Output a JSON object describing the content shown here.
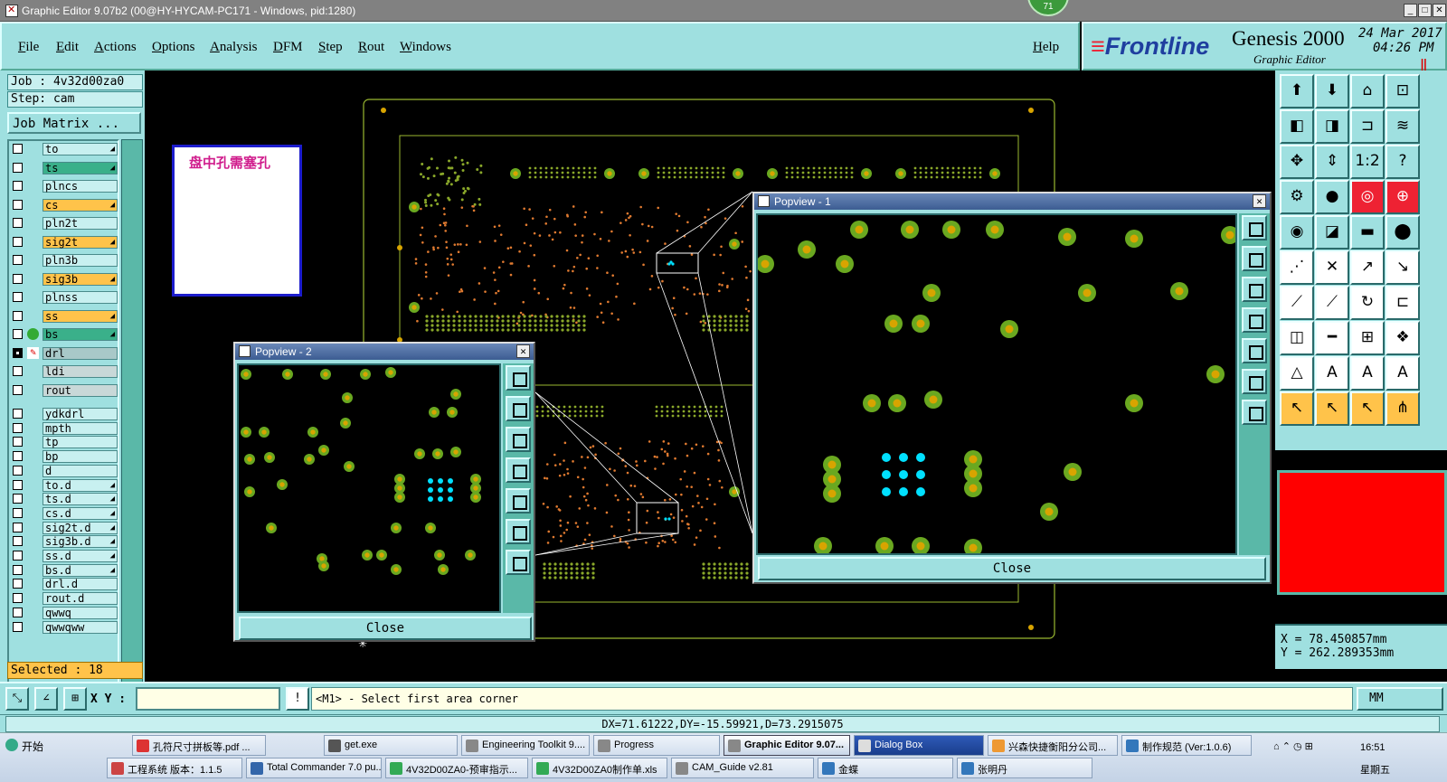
{
  "window": {
    "title": "Graphic Editor 9.07b2 (00@HY-HYCAM-PC171 - Windows, pid:1280)",
    "badge": "71",
    "min_label": "_",
    "max_label": "□",
    "close_label": "✕"
  },
  "menu": {
    "items": [
      "File",
      "Edit",
      "Actions",
      "Options",
      "Analysis",
      "DFM",
      "Step",
      "Rout",
      "Windows"
    ],
    "help": "Help"
  },
  "brand": {
    "logo": "Frontline",
    "product": "Genesis 2000",
    "subtitle": "Graphic Editor",
    "date": "24 Mar 2017",
    "time": "04:26 PM",
    "mark": "‖"
  },
  "job": {
    "job_label": "Job : 4v32d00za0",
    "step_label": "Step: cam",
    "matrix_button": "Job Matrix ..."
  },
  "layers": [
    {
      "name": "to",
      "style": "plain",
      "arrow": true,
      "affected": false
    },
    {
      "name": "ts",
      "style": "green",
      "arrow": true,
      "affected": false
    },
    {
      "name": "plncs",
      "style": "plain",
      "arrow": false,
      "affected": false
    },
    {
      "name": "cs",
      "style": "sig",
      "arrow": true,
      "affected": false
    },
    {
      "name": "pln2t",
      "style": "plain",
      "arrow": false,
      "affected": false
    },
    {
      "name": "sig2t",
      "style": "sig",
      "arrow": true,
      "affected": false
    },
    {
      "name": "pln3b",
      "style": "plain",
      "arrow": false,
      "affected": false
    },
    {
      "name": "sig3b",
      "style": "sig",
      "arrow": true,
      "affected": false
    },
    {
      "name": "plnss",
      "style": "plain",
      "arrow": false,
      "affected": false
    },
    {
      "name": "ss",
      "style": "sig",
      "arrow": true,
      "affected": false
    },
    {
      "name": "bs",
      "style": "green",
      "arrow": true,
      "affected": false,
      "display": true
    },
    {
      "name": "drl",
      "style": "selblue",
      "arrow": false,
      "affected": true,
      "work": true
    },
    {
      "name": "ldi",
      "style": "grey",
      "arrow": false,
      "affected": false
    },
    {
      "name": "rout",
      "style": "grey",
      "arrow": false,
      "affected": false
    },
    {
      "name": "ydkdrl",
      "style": "plain",
      "arrow": false,
      "affected": false
    },
    {
      "name": "mpth",
      "style": "plain",
      "arrow": false,
      "affected": false
    },
    {
      "name": "tp",
      "style": "plain",
      "arrow": false,
      "affected": false
    },
    {
      "name": "bp",
      "style": "plain",
      "arrow": false,
      "affected": false
    },
    {
      "name": "d",
      "style": "plain",
      "arrow": false,
      "affected": false
    },
    {
      "name": "to.d",
      "style": "plain",
      "arrow": true,
      "affected": false
    },
    {
      "name": "ts.d",
      "style": "plain",
      "arrow": true,
      "affected": false
    },
    {
      "name": "cs.d",
      "style": "plain",
      "arrow": true,
      "affected": false
    },
    {
      "name": "sig2t.d",
      "style": "plain",
      "arrow": true,
      "affected": false
    },
    {
      "name": "sig3b.d",
      "style": "plain",
      "arrow": true,
      "affected": false
    },
    {
      "name": "ss.d",
      "style": "plain",
      "arrow": true,
      "affected": false
    },
    {
      "name": "bs.d",
      "style": "plain",
      "arrow": true,
      "affected": false
    },
    {
      "name": "drl.d",
      "style": "plain",
      "arrow": false,
      "affected": false
    },
    {
      "name": "rout.d",
      "style": "plain",
      "arrow": false,
      "affected": false
    },
    {
      "name": "qwwq",
      "style": "plain",
      "arrow": false,
      "affected": false
    },
    {
      "name": "qwwqww",
      "style": "plain",
      "arrow": false,
      "affected": false
    }
  ],
  "selected_label": "Selected : 18",
  "note": {
    "text": "盘中孔需塞孔"
  },
  "popview1": {
    "title": "Popview - 1",
    "close_label": "Close"
  },
  "popview2": {
    "title": "Popview - 2",
    "close_label": "Close"
  },
  "colors": {
    "panel": "#9fe0e0",
    "outline": "#9ab830",
    "pad_outer": "#6aa820",
    "pad_inner": "#d8a400",
    "drill": "#00e0ff",
    "trace": "#e07a30",
    "preview": "#ff0000"
  },
  "coords": {
    "x": "X  =  78.450857mm",
    "y": "Y  = 262.289353mm"
  },
  "command": {
    "xy_label": "X Y :",
    "xy_value": "",
    "prompt": "<M1> - Select first area corner",
    "unit": "MM"
  },
  "status": "DX=71.61222,DY=-15.59921,D=73.2915075",
  "taskbar": {
    "start": "开始",
    "row1": [
      "孔符尺寸拼板等.pdf ...",
      "get.exe",
      "Engineering Toolkit 9....",
      "Progress",
      "Graphic Editor 9.07...",
      "Dialog Box",
      "兴森快捷衡阳分公司...",
      "制作规范 (Ver:1.0.6)"
    ],
    "row2": [
      "工程系统   版本：1.1.5",
      "Total Commander 7.0 pu...",
      "4V32D00ZA0-预审指示...",
      "4V32D00ZA0制作单.xls",
      "CAM_Guide v2.81",
      "金蝶",
      "张明丹"
    ],
    "clock": "16:51",
    "weekday": "星期五"
  }
}
